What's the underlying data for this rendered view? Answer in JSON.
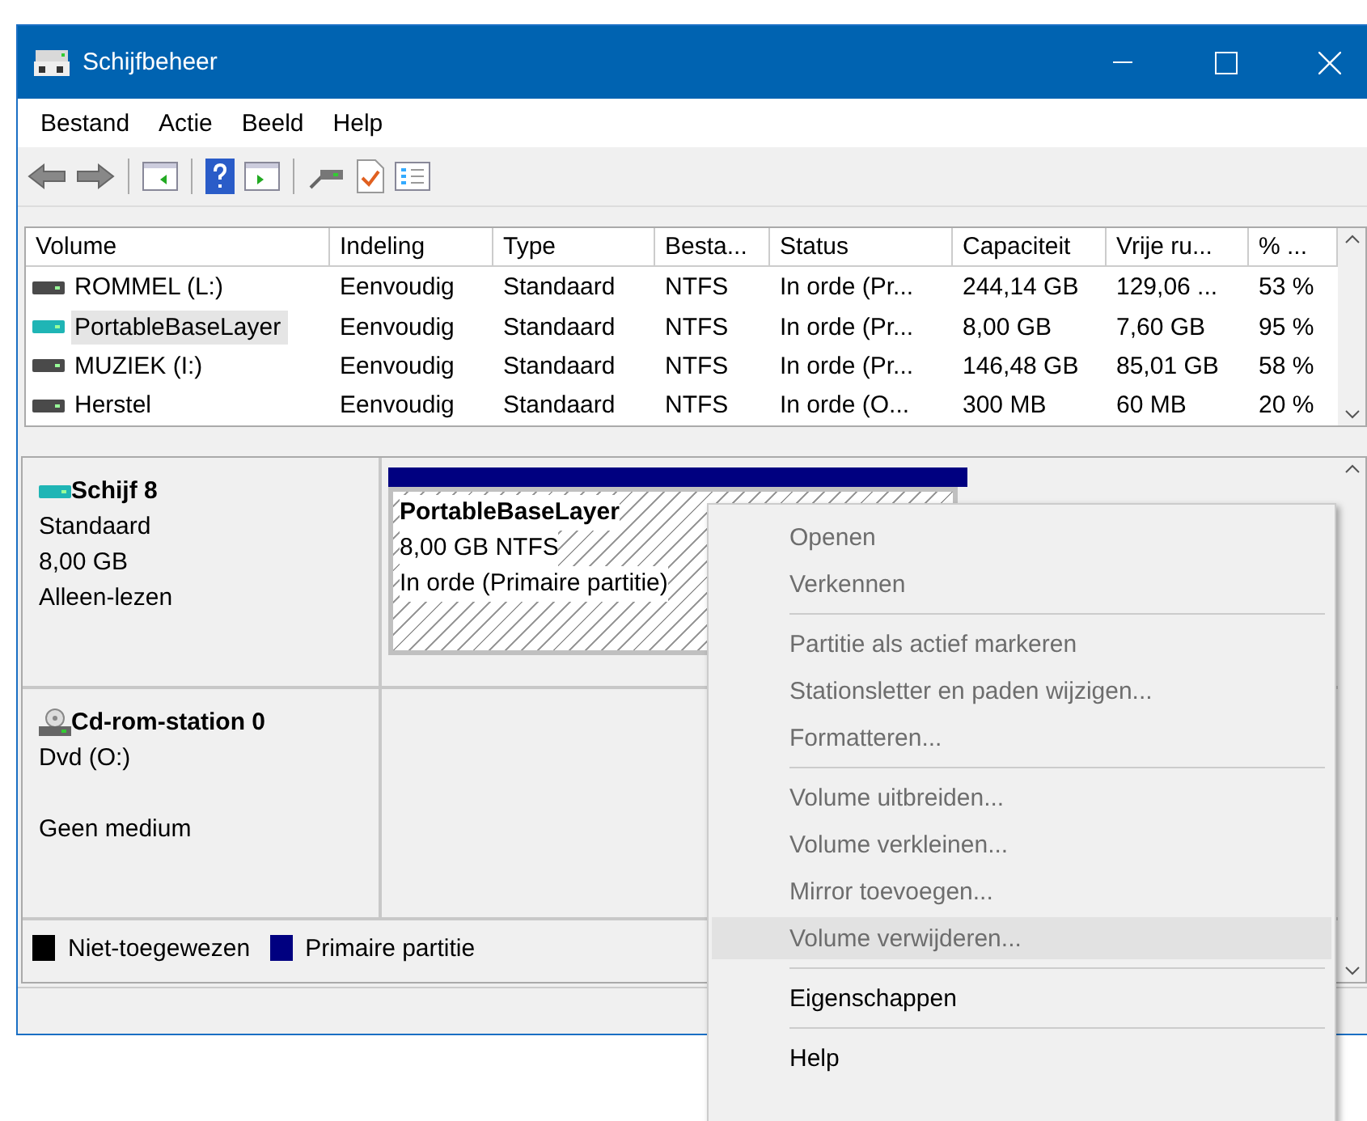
{
  "window": {
    "title": "Schijfbeheer"
  },
  "menu": [
    "Bestand",
    "Actie",
    "Beeld",
    "Help"
  ],
  "volumes": {
    "columns": [
      "Volume",
      "Indeling",
      "Type",
      "Besta...",
      "Status",
      "Capaciteit",
      "Vrije ru...",
      "% ..."
    ],
    "rows": [
      {
        "selected": false,
        "cells": [
          "ROMMEL (L:)",
          "Eenvoudig",
          "Standaard",
          "NTFS",
          "In orde (Pr...",
          "244,14 GB",
          "129,06 ...",
          "53 %"
        ]
      },
      {
        "selected": true,
        "cells": [
          "PortableBaseLayer",
          "Eenvoudig",
          "Standaard",
          "NTFS",
          "In orde (Pr...",
          "8,00 GB",
          "7,60 GB",
          "95 %"
        ]
      },
      {
        "selected": false,
        "cells": [
          "MUZIEK (I:)",
          "Eenvoudig",
          "Standaard",
          "NTFS",
          "In orde (Pr...",
          "146,48 GB",
          "85,01 GB",
          "58 %"
        ]
      },
      {
        "selected": false,
        "cells": [
          "Herstel",
          "Eenvoudig",
          "Standaard",
          "NTFS",
          "In orde (O...",
          "300 MB",
          "60 MB",
          "20 %"
        ]
      }
    ]
  },
  "disks": [
    {
      "kind": "disk",
      "name": "Schijf 8",
      "lines": [
        "Standaard",
        "8,00 GB",
        "Alleen-lezen"
      ],
      "partitions": [
        {
          "name": "PortableBaseLayer",
          "lines": [
            "8,00 GB NTFS",
            "In orde (Primaire partitie)"
          ]
        }
      ]
    },
    {
      "kind": "cdrom",
      "name": "Cd-rom-station 0",
      "lines": [
        "Dvd (O:)",
        "Geen medium"
      ]
    }
  ],
  "legend": [
    {
      "label": "Niet-toegewezen",
      "color": "#000000"
    },
    {
      "label": "Primaire partitie",
      "color": "#000080"
    }
  ],
  "context_menu": {
    "groups": [
      [
        {
          "label": "Openen",
          "disabled": true,
          "selected": false
        },
        {
          "label": "Verkennen",
          "disabled": true,
          "selected": false
        }
      ],
      [
        {
          "label": "Partitie als actief markeren",
          "disabled": true,
          "selected": false
        },
        {
          "label": "Stationsletter en paden wijzigen...",
          "disabled": true,
          "selected": false
        },
        {
          "label": "Formatteren...",
          "disabled": true,
          "selected": false
        }
      ],
      [
        {
          "label": "Volume uitbreiden...",
          "disabled": true,
          "selected": false
        },
        {
          "label": "Volume verkleinen...",
          "disabled": true,
          "selected": false
        },
        {
          "label": "Mirror toevoegen...",
          "disabled": true,
          "selected": false
        },
        {
          "label": "Volume verwijderen...",
          "disabled": true,
          "selected": true
        }
      ],
      [
        {
          "label": "Eigenschappen",
          "disabled": false,
          "selected": false
        }
      ],
      [
        {
          "label": "Help",
          "disabled": false,
          "selected": false
        }
      ]
    ]
  }
}
